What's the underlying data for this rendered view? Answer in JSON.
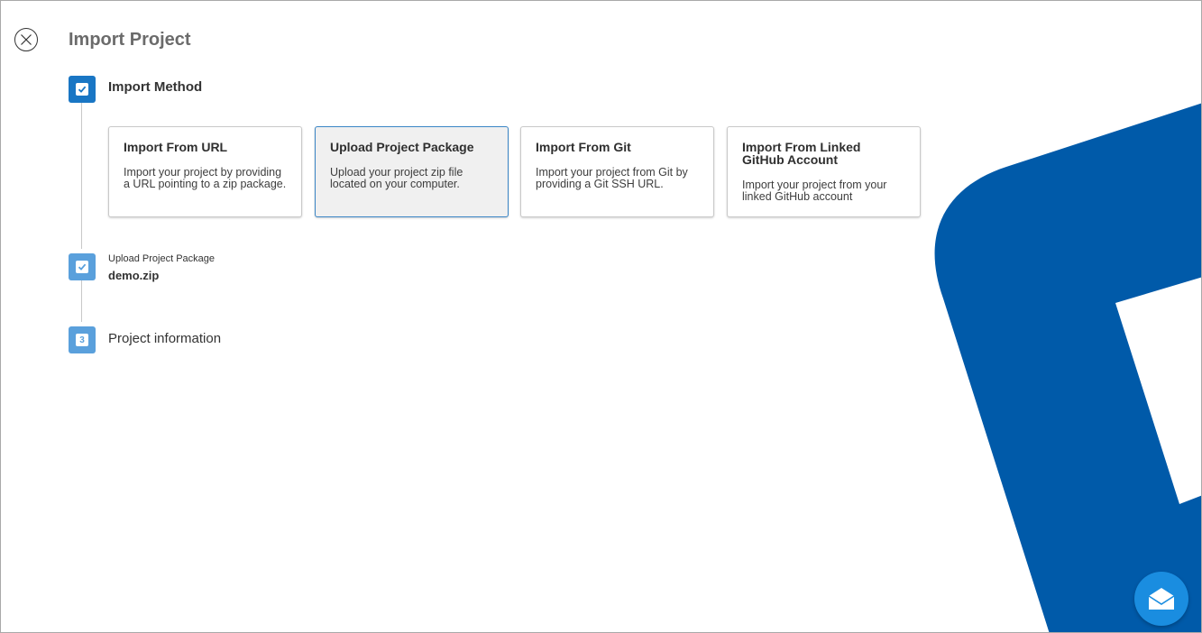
{
  "header": {
    "title": "Import Project",
    "close_icon": "close-circle-icon"
  },
  "steps": {
    "step1": {
      "label": "Import Method",
      "icon": "checkbox-checked-icon"
    },
    "step2": {
      "label": "Upload Project Package",
      "value": "demo.zip",
      "icon": "checkbox-checked-icon"
    },
    "step3": {
      "number": "3",
      "label": "Project information"
    }
  },
  "import_methods": [
    {
      "title": "Import From URL",
      "description": "Import your project by providing a URL pointing to a zip package.",
      "selected": false
    },
    {
      "title": "Upload Project Package",
      "description": "Upload your project zip file located on your computer.",
      "selected": true
    },
    {
      "title": "Import From Git",
      "description": "Import your project from Git by providing a Git SSH URL.",
      "selected": false
    },
    {
      "title": "Import From Linked GitHub Account",
      "description": "Import your project from your linked GitHub account",
      "selected": false
    }
  ],
  "fab": {
    "icon": "envelope-open-icon"
  },
  "colors": {
    "brand_blue": "#005aa9",
    "step_active": "#1976c4",
    "step_done": "#5aa0dc",
    "fab": "#1a8de0",
    "selected_border": "#3b86c6"
  }
}
